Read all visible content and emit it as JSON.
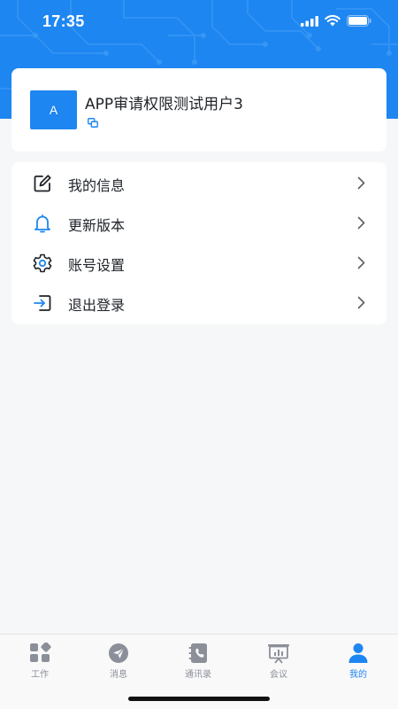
{
  "status_bar": {
    "time": "17:35"
  },
  "profile": {
    "avatar_letter": "A",
    "name": "APP审请权限测试用户3"
  },
  "menu": [
    {
      "label": "我的信息",
      "icon": "edit-icon"
    },
    {
      "label": "更新版本",
      "icon": "bell-icon"
    },
    {
      "label": "账号设置",
      "icon": "gear-icon"
    },
    {
      "label": "退出登录",
      "icon": "logout-icon"
    }
  ],
  "tabs": [
    {
      "label": "工作",
      "icon": "grid-icon",
      "active": false
    },
    {
      "label": "消息",
      "icon": "message-icon",
      "active": false
    },
    {
      "label": "通讯录",
      "icon": "contacts-icon",
      "active": false
    },
    {
      "label": "会议",
      "icon": "meeting-icon",
      "active": false
    },
    {
      "label": "我的",
      "icon": "person-icon",
      "active": true
    }
  ],
  "colors": {
    "accent": "#1e86f1",
    "background": "#f5f7f8",
    "inactive": "#8a8f99"
  }
}
